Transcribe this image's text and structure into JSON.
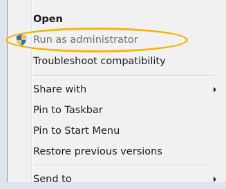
{
  "menu": {
    "items": [
      {
        "label": "Open"
      },
      {
        "label": "Run as administrator"
      },
      {
        "label": "Troubleshoot compatibility"
      },
      {
        "label": "Share with"
      },
      {
        "label": "Pin to Taskbar"
      },
      {
        "label": "Pin to Start Menu"
      },
      {
        "label": "Restore previous versions"
      },
      {
        "label": "Send to"
      }
    ]
  },
  "colors": {
    "highlight": "#f5b400",
    "menu_background": "#f1f1f1"
  },
  "icons": {
    "run_as_admin": "uac-shield-icon",
    "submenu": "chevron-right-icon"
  }
}
